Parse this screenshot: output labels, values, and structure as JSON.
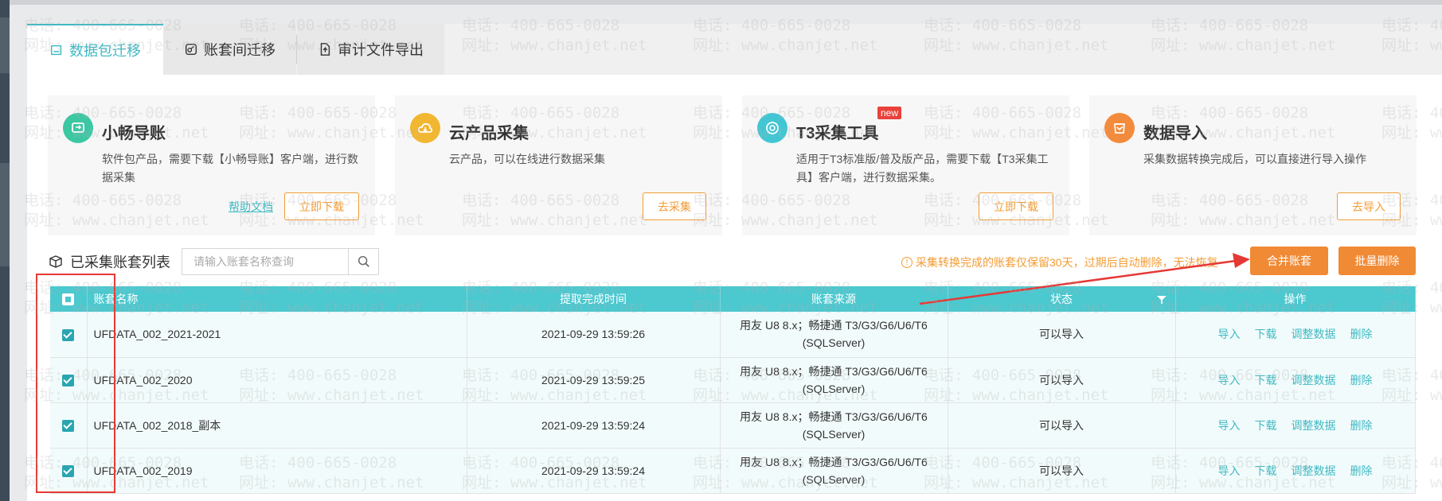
{
  "tabs": [
    {
      "label": "数据包迁移",
      "active": true
    },
    {
      "label": "账套间迁移",
      "active": false
    },
    {
      "label": "审计文件导出",
      "active": false
    }
  ],
  "cards": [
    {
      "title": "小畅导账",
      "desc": "软件包产品，需要下载【小畅导账】客户端，进行数据采集",
      "link": "帮助文档",
      "button": "立即下载",
      "icon": "transfer-icon",
      "color": "#3cc7a3",
      "badge": ""
    },
    {
      "title": "云产品采集",
      "desc": "云产品，可以在线进行数据采集",
      "link": "",
      "button": "去采集",
      "icon": "cloud-icon",
      "color": "#f2b731",
      "badge": ""
    },
    {
      "title": "T3采集工具",
      "desc": "适用于T3标准版/普及版产品，需要下载【T3采集工具】客户端，进行数据采集。",
      "link": "",
      "button": "立即下载",
      "icon": "target-icon",
      "color": "#43c6d3",
      "badge": "new"
    },
    {
      "title": "数据导入",
      "desc": "采集数据转换完成后，可以直接进行导入操作",
      "link": "",
      "button": "去导入",
      "icon": "import-icon",
      "color": "#f38b3d",
      "badge": ""
    }
  ],
  "list": {
    "title": "已采集账套列表",
    "search_placeholder": "请输入账套名称查询"
  },
  "notice": "采集转换完成的账套仅保留30天，过期后自动删除，无法恢复",
  "notice_icon": "!",
  "buttons": {
    "merge": "合并账套",
    "batch_delete": "批量删除"
  },
  "table": {
    "columns": [
      "账套名称",
      "提取完成时间",
      "账套来源",
      "状态",
      "操作"
    ],
    "rows": [
      {
        "name": "UFDATA_002_2021-2021",
        "time": "2021-09-29 13:59:26",
        "source": "用友 U8 8.x；畅捷通 T3/G3/G6/U6/T6 (SQLServer)",
        "status": "可以导入"
      },
      {
        "name": "UFDATA_002_2020",
        "time": "2021-09-29 13:59:25",
        "source": "用友 U8 8.x；畅捷通 T3/G3/G6/U6/T6 (SQLServer)",
        "status": "可以导入"
      },
      {
        "name": "UFDATA_002_2018_副本",
        "time": "2021-09-29 13:59:24",
        "source": "用友 U8 8.x；畅捷通 T3/G3/G6/U6/T6 (SQLServer)",
        "status": "可以导入"
      },
      {
        "name": "UFDATA_002_2019",
        "time": "2021-09-29 13:59:24",
        "source": "用友 U8 8.x；畅捷通 T3/G3/G6/U6/T6 (SQLServer)",
        "status": "可以导入"
      }
    ],
    "actions": [
      "导入",
      "下载",
      "调整数据",
      "删除"
    ]
  },
  "watermark": {
    "phone": "电话: 400-665-0028",
    "site": "网址: www.chanjet.net"
  },
  "colors": {
    "accent": "#3fb9c4",
    "header": "#4cc8cf",
    "orange": "#f08a35",
    "annotation_red": "#e53935"
  }
}
